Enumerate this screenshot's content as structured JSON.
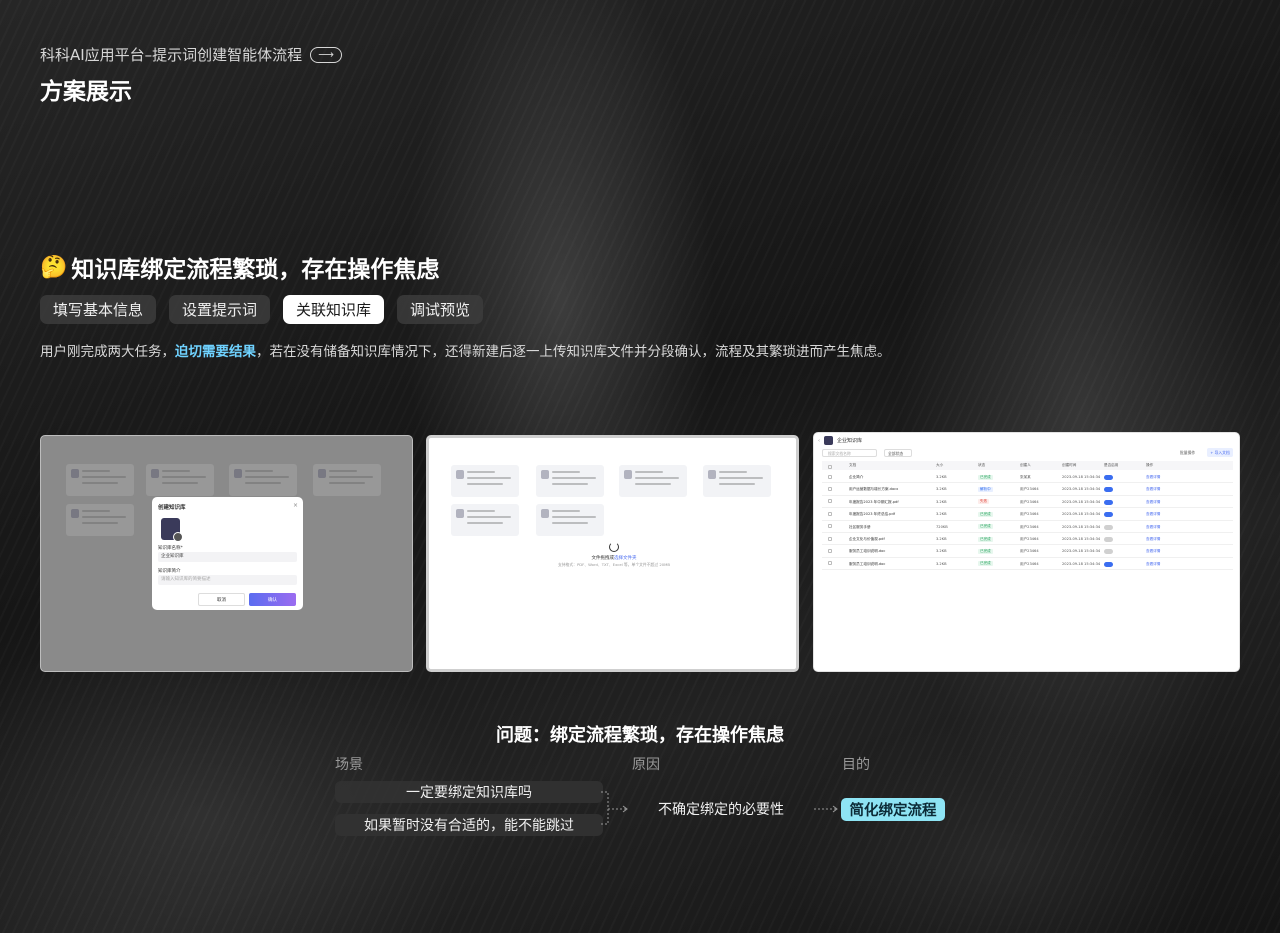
{
  "header": {
    "subtitle": "科科AI应用平台–提示词创建智能体流程",
    "arrow": "⟶",
    "title": "方案展示"
  },
  "section": {
    "emoji": "🤔",
    "title": "知识库绑定流程繁琐，存在操作焦虑",
    "steps": [
      {
        "label": "填写基本信息",
        "active": false
      },
      {
        "label": "设置提示词",
        "active": false
      },
      {
        "label": "关联知识库",
        "active": true
      },
      {
        "label": "调试预览",
        "active": false
      }
    ],
    "description": {
      "before": "用户刚完成两大任务，",
      "highlight": "迫切需要结果",
      "after": "，若在没有储备知识库情况下，还得新建后逐一上传知识库文件并分段确认，流程及其繁琐进而产生焦虑。"
    }
  },
  "shot1": {
    "dialog_title": "创建知识库",
    "close": "×",
    "name_label": "知识库名称*",
    "name_value": "企业知识库",
    "desc_label": "知识库简介",
    "desc_placeholder": "请输入知识库的简要描述",
    "cancel": "取消",
    "confirm": "确认"
  },
  "shot2": {
    "upload_main": "文件拖拽或",
    "upload_link": "选择文件夹",
    "upload_hint": "支持格式：PDF、Word、TXT、Excel 等，单个文件不超过 20MB"
  },
  "shot3": {
    "title": "企业知识库",
    "search_placeholder": "搜索文档名称",
    "filter": "全部状态",
    "btn_settings": "批量操作",
    "btn_add": "+ 导入文档",
    "columns": [
      "文档",
      "大小",
      "状态",
      "创建人",
      "创建时间",
      "是否启用",
      "操作"
    ],
    "rows": [
      {
        "file": "企业简介",
        "size": "3.2KB",
        "status": "已完成",
        "owner": "张某某",
        "time": "2023-09-18 15:34:34",
        "on": true,
        "act": "查看详情"
      },
      {
        "file": "用户运营数据与增长方案.docx",
        "size": "3.2KB",
        "status": "解析中",
        "owner": "用户23464",
        "time": "2023-09-18 15:34:34",
        "on": true,
        "act": "查看详情"
      },
      {
        "file": "年度报告2023 年中期汇报.pdf",
        "size": "3.2KB",
        "status": "失败",
        "owner": "用户23464",
        "time": "2023-09-18 15:34:34",
        "on": true,
        "act": "查看详情"
      },
      {
        "file": "年度报告2023 年终总结.pdf",
        "size": "3.2KB",
        "status": "已完成",
        "owner": "用户23464",
        "time": "2023-09-18 15:34:34",
        "on": true,
        "act": "查看详情"
      },
      {
        "file": "社区服务手册",
        "size": "720KB",
        "status": "已完成",
        "owner": "用户23464",
        "time": "2023-09-18 15:34:34",
        "on": false,
        "act": "查看详情"
      },
      {
        "file": "企业文化与价值观.pdf",
        "size": "3.2KB",
        "status": "已完成",
        "owner": "用户23464",
        "time": "2023-09-18 15:34:34",
        "on": false,
        "act": "查看详情"
      },
      {
        "file": "服务员工培训说明.doc",
        "size": "3.2KB",
        "status": "已完成",
        "owner": "用户23464",
        "time": "2023-09-18 15:34:34",
        "on": false,
        "act": "查看详情"
      },
      {
        "file": "服务员工培训说明.doc",
        "size": "3.2KB",
        "status": "已完成",
        "owner": "用户23464",
        "time": "2023-09-18 15:34:34",
        "on": true,
        "act": "查看详情"
      }
    ]
  },
  "problem": {
    "title": "问题：绑定流程繁琐，存在操作焦虑",
    "labels": {
      "scene": "场景",
      "reason": "原因",
      "goal": "目的"
    },
    "scenes": [
      "一定要绑定知识库吗",
      "如果暂时没有合适的，能不能跳过"
    ],
    "reason": "不确定绑定的必要性",
    "goal": "简化绑定流程"
  },
  "colors": {
    "accent": "#6fd2ff",
    "goal_bg": "#8ee4f4"
  }
}
